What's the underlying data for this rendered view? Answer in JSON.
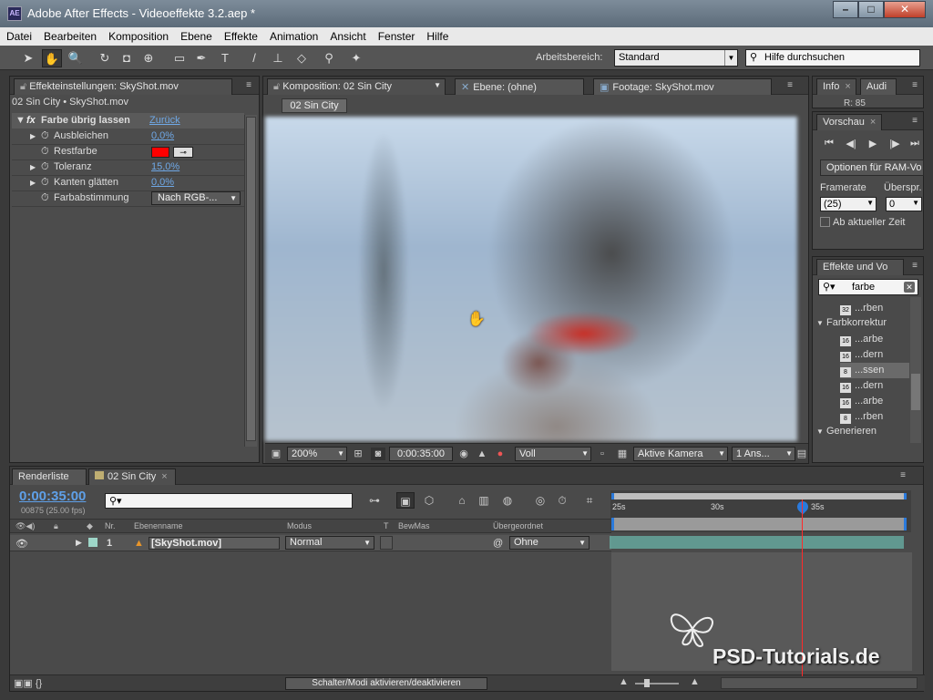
{
  "window": {
    "app_icon": "AE",
    "title": "Adobe After Effects - Videoeffekte 3.2.aep *",
    "minimize": "–",
    "maximize": "□",
    "close": "✕"
  },
  "menu": [
    "Datei",
    "Bearbeiten",
    "Komposition",
    "Ebene",
    "Effekte",
    "Animation",
    "Ansicht",
    "Fenster",
    "Hilfe"
  ],
  "toolbar": {
    "tools": [
      {
        "name": "selection-tool-icon",
        "glyph": "➤"
      },
      {
        "name": "hand-tool-icon",
        "glyph": "✋"
      },
      {
        "name": "zoom-tool-icon",
        "glyph": "🔍"
      },
      {
        "name": "rotate-tool-icon",
        "glyph": "↻"
      },
      {
        "name": "camera-tool-icon",
        "glyph": "◘"
      },
      {
        "name": "pan-behind-tool-icon",
        "glyph": "⊕"
      },
      {
        "name": "rectangle-tool-icon",
        "glyph": "▭"
      },
      {
        "name": "pen-tool-icon",
        "glyph": "✒"
      },
      {
        "name": "text-tool-icon",
        "glyph": "T"
      },
      {
        "name": "brush-tool-icon",
        "glyph": "/"
      },
      {
        "name": "clone-stamp-tool-icon",
        "glyph": "⊥"
      },
      {
        "name": "eraser-tool-icon",
        "glyph": "◇"
      },
      {
        "name": "roto-brush-tool-icon",
        "glyph": "⚲"
      },
      {
        "name": "puppet-pin-tool-icon",
        "glyph": "✦"
      }
    ],
    "workspace_label": "Arbeitsbereich:",
    "workspace_value": "Standard",
    "help_placeholder": "Hilfe durchsuchen"
  },
  "effect_controls": {
    "tab_label": "Effekteinstellungen: SkyShot.mov",
    "subtitle": "02 Sin City • SkyShot.mov",
    "effect_name": "Farbe übrig lassen",
    "reset_label": "Zurück",
    "fx_badge": "fx",
    "properties": [
      {
        "label": "Ausbleichen",
        "value": "0,0%"
      },
      {
        "label": "Restfarbe",
        "value": ""
      },
      {
        "label": "Toleranz",
        "value": "15,0%"
      },
      {
        "label": "Kanten glätten",
        "value": "0,0%"
      },
      {
        "label": "Farbabstimmung",
        "value": "Nach RGB-..."
      }
    ],
    "keep_color": "#ff0000"
  },
  "composition": {
    "tab_label": "Komposition: 02 Sin City",
    "layer_tab": "Ebene: (ohne)",
    "footage_tab": "Footage: SkyShot.mov",
    "crumb": "02 Sin City",
    "footer": {
      "zoom": "200%",
      "timecode": "0:00:35:00",
      "resolution": "Voll",
      "camera": "Aktive Kamera",
      "views": "1 Ans..."
    }
  },
  "info": {
    "tab": "Info",
    "tab2": "Audi",
    "r_value": "R:  85"
  },
  "preview": {
    "tab": "Vorschau",
    "ram_options": "Optionen für RAM-Vo",
    "framerate_label": "Framerate",
    "skip_label": "Überspr.",
    "framerate_value": "(25)",
    "skip_value": "0",
    "from_current": "Ab aktueller Zeit"
  },
  "effects_presets": {
    "tab": "Effekte und Vo",
    "search_value": "farbe",
    "items_before": [
      {
        "label": "...rben",
        "badge": "32"
      }
    ],
    "category": "Farbkorrektur",
    "items": [
      {
        "label": "...arbe",
        "badge": "16"
      },
      {
        "label": "...dern",
        "badge": "16"
      },
      {
        "label": "...ssen",
        "badge": "8"
      },
      {
        "label": "...dern",
        "badge": "16"
      },
      {
        "label": "...arbe",
        "badge": "16"
      },
      {
        "label": "...rben",
        "badge": "8"
      }
    ],
    "category2": "Generieren"
  },
  "timeline": {
    "render_tab": "Renderliste",
    "comp_tab": "02 Sin City",
    "time": "0:00:35:00",
    "frames": "00875 (25.00 fps)",
    "search_placeholder": "",
    "headers": {
      "nr": "Nr.",
      "name": "Ebenenname",
      "mode": "Modus",
      "t": "T",
      "trkmat": "BewMas",
      "parent": "Übergeordnet"
    },
    "layer": {
      "number": "1",
      "name": "[SkyShot.mov]",
      "mode": "Normal",
      "parent": "Ohne"
    },
    "ruler": [
      "25s",
      "30s",
      "35s"
    ],
    "toggle_label": "Schalter/Modi aktivieren/deaktivieren",
    "layer_color": "#9ed6c8"
  },
  "watermark": {
    "text": "PSD-Tutorials.de"
  }
}
